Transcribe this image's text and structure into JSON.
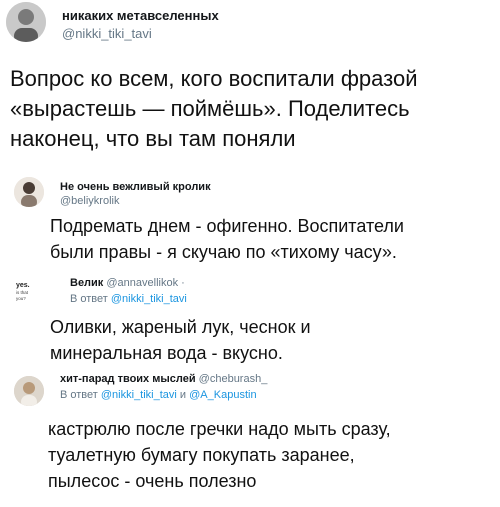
{
  "tweets": [
    {
      "name": "никаких метавселенных",
      "handle": "@nikki_tiki_tavi",
      "lines": [
        "Вопрос ко всем, кого воспитали фразой",
        "«вырастешь — поймёшь». Поделитесь",
        "наконец, что вы там поняли"
      ]
    },
    {
      "name": "Не очень вежливый кролик",
      "handle": "@beliykrolik",
      "lines": [
        "Подремать днем - офигенно. Воспитатели",
        "были правы - я скучаю по «тихому часу»."
      ]
    },
    {
      "name": "Велик",
      "handle": "@annavellikok ·",
      "reply_prefix": "В ответ",
      "reply_to": "@nikki_tiki_tavi",
      "avatar_text": "yes. is that you?",
      "lines": [
        "Оливки, жареный лук, чеснок и",
        "минеральная вода - вкусно."
      ]
    },
    {
      "name": "хит-парад твоих мыслей",
      "handle": "@cheburash_",
      "reply_prefix": "В ответ",
      "reply_to": "@nikki_tiki_tavi",
      "reply_and": "и",
      "reply_to_2": "@A_Kapustin",
      "lines": [
        "кастрюлю после гречки надо мыть сразу,",
        "туалетную бумагу покупать заранее,",
        "пылесос - очень полезно"
      ]
    }
  ]
}
